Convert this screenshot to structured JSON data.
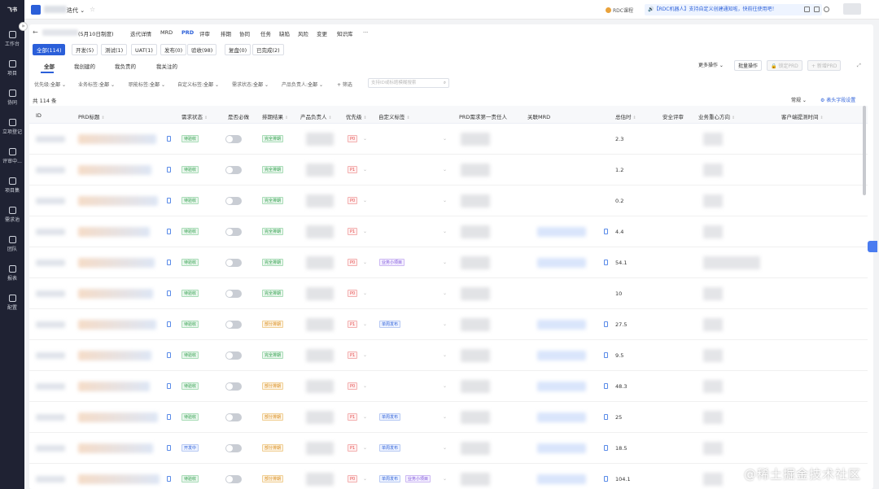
{
  "sidebar": {
    "logo": "飞书",
    "collapse_label": "»",
    "items": [
      {
        "label": "工作台",
        "icon": "grid-icon"
      },
      {
        "label": "项目",
        "icon": "folder-icon"
      },
      {
        "label": "协同",
        "icon": "flow-icon"
      },
      {
        "label": "立项登记",
        "icon": "register-icon"
      },
      {
        "label": "评审中...",
        "icon": "review-icon"
      },
      {
        "label": "项目集",
        "icon": "table-icon"
      },
      {
        "label": "需求池",
        "icon": "pool-icon"
      },
      {
        "label": "团队",
        "icon": "team-icon"
      },
      {
        "label": "报表",
        "icon": "chart-icon"
      },
      {
        "label": "配置",
        "icon": "config-icon"
      }
    ]
  },
  "topbar": {
    "project_title": "迭代 ⌄",
    "rdc_label": "RDC课程",
    "notice": "🔊【RDC机器人】支持自定义创建通知啦，快前往使用吧！"
  },
  "nav": {
    "items": [
      {
        "label": "(5月10日制度)"
      },
      {
        "label": "迭代详情"
      },
      {
        "label": "MRD"
      },
      {
        "label": "PRD",
        "active": true
      },
      {
        "label": "评审"
      },
      {
        "label": "排期"
      },
      {
        "label": "协同"
      },
      {
        "label": "任务"
      },
      {
        "label": "缺陷"
      },
      {
        "label": "风险"
      },
      {
        "label": "变更"
      },
      {
        "label": "知识库"
      },
      {
        "label": "···"
      }
    ]
  },
  "status_tabs": [
    {
      "label": "全部(114)",
      "active": true
    },
    {
      "label": "开发(5)"
    },
    {
      "label": "测试(1)"
    },
    {
      "label": "UAT(1)"
    },
    {
      "label": "发布(0)"
    },
    {
      "label": "验收(98)"
    },
    {
      "label": "复盘(0)"
    },
    {
      "label": "已完成(2)"
    }
  ],
  "owner_tabs": [
    {
      "label": "全部",
      "active": true
    },
    {
      "label": "我创建的"
    },
    {
      "label": "我负责的"
    },
    {
      "label": "我关注的"
    }
  ],
  "actions": {
    "more": "更多操作 ⌄",
    "batch": "批量操作",
    "lock": "🔒 锁定PRD",
    "add": "+ 新增PRD"
  },
  "filters": [
    {
      "label": "优先级:",
      "value": "全部"
    },
    {
      "label": "业务标签:",
      "value": "全部"
    },
    {
      "label": "职能标签:",
      "value": "全部"
    },
    {
      "label": "自定义标签:",
      "value": "全部"
    },
    {
      "label": "需求状态:",
      "value": "全部"
    },
    {
      "label": "产品负责人:",
      "value": "全部"
    },
    {
      "label": "+ 筛选",
      "value": ""
    }
  ],
  "search": {
    "placeholder": "支持ID或标题模糊搜索"
  },
  "summary": {
    "total": "共 114 条",
    "mode": "常规 ⌄",
    "set_columns": "⚙ 表头字段设置"
  },
  "columns": [
    "ID",
    "PRD标题",
    "需求状态",
    "是否必做",
    "排期结果",
    "产品负责人",
    "优先级",
    "自定义标签",
    "PRD需求第一责任人",
    "关联MRD",
    "总估时",
    "安全评审",
    "业务重心方向",
    "客户端提测时间"
  ],
  "rows": [
    {
      "status": "待验收",
      "status_tone": "green",
      "schedule": "完全排期",
      "schedule_tone": "green",
      "priority": "P0",
      "custom_tags": [],
      "mrd": false,
      "hours": "2.3"
    },
    {
      "status": "待验收",
      "status_tone": "green",
      "schedule": "完全排期",
      "schedule_tone": "green",
      "priority": "P1",
      "custom_tags": [],
      "mrd": false,
      "hours": "1.2"
    },
    {
      "status": "待验收",
      "status_tone": "green",
      "schedule": "完全排期",
      "schedule_tone": "green",
      "priority": "P0",
      "custom_tags": [],
      "mrd": false,
      "hours": "0.2"
    },
    {
      "status": "待验收",
      "status_tone": "green",
      "schedule": "完全排期",
      "schedule_tone": "green",
      "priority": "P1",
      "custom_tags": [],
      "mrd": true,
      "hours": "4.4"
    },
    {
      "status": "待验收",
      "status_tone": "green",
      "schedule": "完全排期",
      "schedule_tone": "green",
      "priority": "P0",
      "custom_tags": [
        {
          "label": "业务小项目",
          "tone": "purple"
        }
      ],
      "mrd": true,
      "hours": "54.1"
    },
    {
      "status": "待验收",
      "status_tone": "green",
      "schedule": "完全排期",
      "schedule_tone": "green",
      "priority": "P0",
      "custom_tags": [],
      "mrd": false,
      "hours": "10"
    },
    {
      "status": "待验收",
      "status_tone": "green",
      "schedule": "部分排期",
      "schedule_tone": "orange",
      "priority": "P1",
      "custom_tags": [
        {
          "label": "单周发布",
          "tone": "blue"
        }
      ],
      "mrd": true,
      "hours": "27.5"
    },
    {
      "status": "待验收",
      "status_tone": "green",
      "schedule": "完全排期",
      "schedule_tone": "green",
      "priority": "P1",
      "custom_tags": [],
      "mrd": true,
      "hours": "9.5"
    },
    {
      "status": "待验收",
      "status_tone": "green",
      "schedule": "部分排期",
      "schedule_tone": "orange",
      "priority": "P0",
      "custom_tags": [],
      "mrd": true,
      "hours": "48.3"
    },
    {
      "status": "待验收",
      "status_tone": "green",
      "schedule": "部分排期",
      "schedule_tone": "orange",
      "priority": "P1",
      "custom_tags": [
        {
          "label": "单周发布",
          "tone": "blue"
        }
      ],
      "mrd": true,
      "hours": "25"
    },
    {
      "status": "开发中",
      "status_tone": "blue",
      "schedule": "部分排期",
      "schedule_tone": "orange",
      "priority": "P1",
      "custom_tags": [
        {
          "label": "单周发布",
          "tone": "blue"
        }
      ],
      "mrd": true,
      "hours": "18.5"
    },
    {
      "status": "待验收",
      "status_tone": "green",
      "schedule": "部分排期",
      "schedule_tone": "orange",
      "priority": "P0",
      "custom_tags": [
        {
          "label": "单周发布",
          "tone": "blue"
        },
        {
          "label": "业务小项目",
          "tone": "purple"
        }
      ],
      "mrd": true,
      "hours": "104.1"
    }
  ],
  "watermark": "@稀土掘金技术社区",
  "colors": {
    "accent": "#2b5fd9",
    "sidebar": "#1f2233"
  }
}
